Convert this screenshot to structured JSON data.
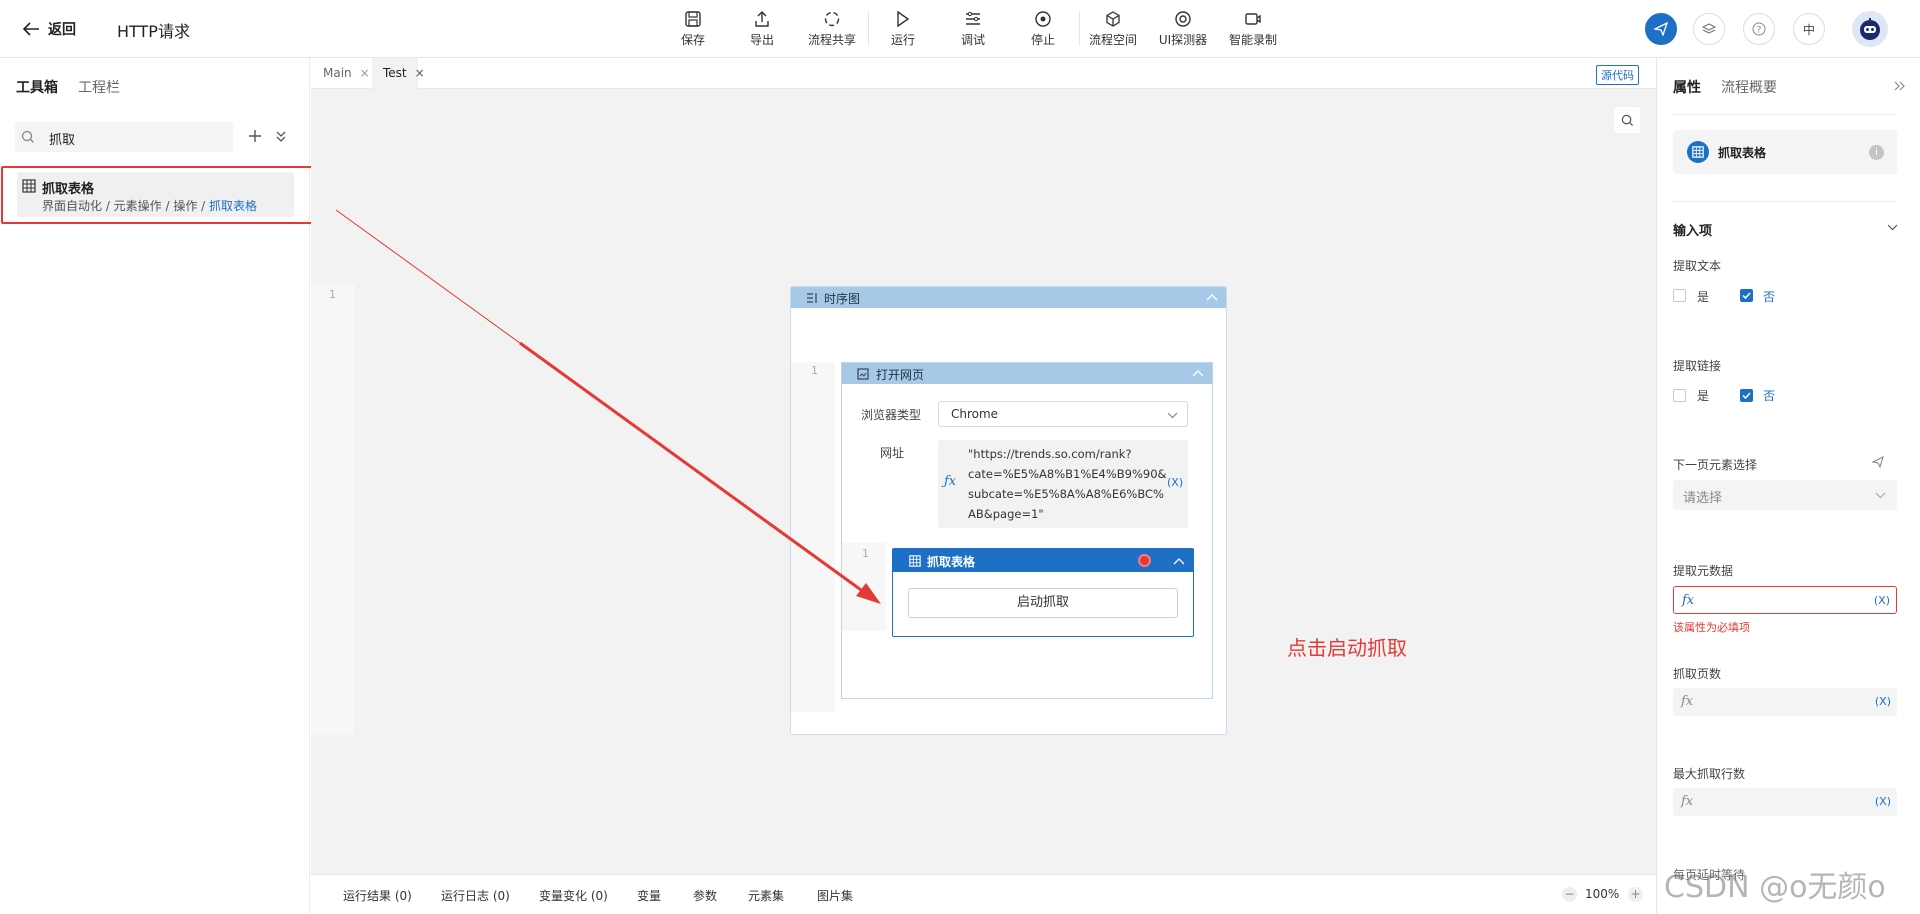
{
  "header": {
    "back_label": "返回",
    "title": "HTTP请求",
    "toolbar": [
      {
        "label": "保存",
        "icon": "save-icon"
      },
      {
        "label": "导出",
        "icon": "export-icon"
      },
      {
        "label": "流程共享",
        "icon": "share-icon"
      },
      {
        "label": "运行",
        "icon": "run-icon"
      },
      {
        "label": "调试",
        "icon": "debug-icon"
      },
      {
        "label": "停止",
        "icon": "stop-icon"
      },
      {
        "label": "流程空间",
        "icon": "cube-icon"
      },
      {
        "label": "UI探测器",
        "icon": "detector-icon"
      },
      {
        "label": "智能录制",
        "icon": "record-icon"
      }
    ],
    "lang_label": "中",
    "accent": "#1e6fc6"
  },
  "left": {
    "tabs": [
      "工具箱",
      "工程栏"
    ],
    "search_value": "抓取",
    "result": {
      "title": "抓取表格",
      "path_prefix": "界面自动化 / 元素操作 / 操作 / ",
      "path_last": "抓取表格"
    }
  },
  "editor": {
    "tabs": [
      "Main",
      "Test"
    ],
    "source_label": "源代码",
    "sequence": {
      "line": "1",
      "title": "时序图",
      "open_page": {
        "line": "1",
        "title": "打开网页",
        "browser_label": "浏览器类型",
        "browser_value": "Chrome",
        "url_label": "网址",
        "url_lines": [
          "\"https://trends.so.com/rank?",
          "cate=%E5%A8%B1%E4%B9%90&",
          "subcate=%E5%8A%A8%E6%BC%",
          "AB&page=1\""
        ],
        "var_label": "(X)"
      },
      "grab_table": {
        "line": "1",
        "title": "抓取表格",
        "button_label": "启动抓取"
      }
    },
    "annotation": "点击启动抓取",
    "annotation_color": "#e53935"
  },
  "right": {
    "tabs": [
      "属性",
      "流程概要"
    ],
    "component_title": "抓取表格",
    "section_title": "输入项",
    "extract_text": {
      "label": "提取文本",
      "yes": "是",
      "no": "否",
      "value": "否"
    },
    "extract_link": {
      "label": "提取链接",
      "yes": "是",
      "no": "否",
      "value": "否"
    },
    "next_page": {
      "label": "下一页元素选择",
      "placeholder": "请选择"
    },
    "extract_meta": {
      "label": "提取元数据",
      "error": "该属性为必填项"
    },
    "pages": {
      "label": "抓取页数"
    },
    "max_rows": {
      "label": "最大抓取行数"
    },
    "fx_label": "fx",
    "var_label": "(X)",
    "cut_label": "每页延时等待"
  },
  "bottom": {
    "items": [
      "运行结果 (0)",
      "运行日志 (0)",
      "变量变化 (0)",
      "变量",
      "参数",
      "元素集",
      "图片集"
    ],
    "zoom": "100%",
    "watermark": "CSDN @o无颜o"
  }
}
